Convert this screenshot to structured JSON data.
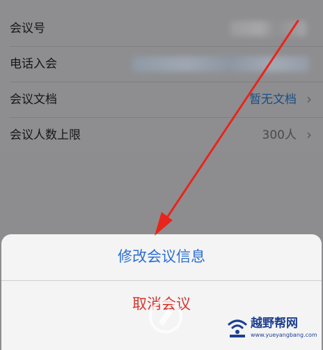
{
  "settings": {
    "rows": [
      {
        "label": "会议号",
        "value": "",
        "blurred": true
      },
      {
        "label": "电话入会",
        "value": "",
        "blurred": true
      },
      {
        "label": "会议文档",
        "value": "暂无文档",
        "chevron": "›"
      },
      {
        "label": "会议人数上限",
        "value": "300人",
        "chevron": "›"
      }
    ]
  },
  "action_sheet": {
    "edit_label": "修改会议信息",
    "cancel_meeting_label": "取消会议"
  },
  "watermark": {
    "site_name": "越野帮网",
    "site_url": "www.yueyangbang.com"
  },
  "colors": {
    "link": "#2b6fd1",
    "destructive": "#d9342b",
    "arrow": "#e8251c"
  }
}
